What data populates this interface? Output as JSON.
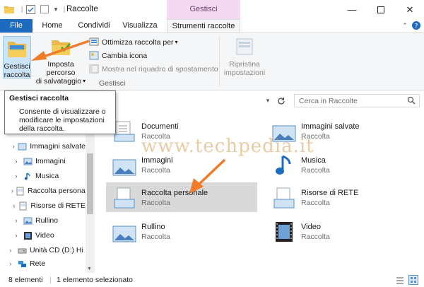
{
  "window": {
    "title": "Raccolte",
    "context_label": "Gestisci"
  },
  "tabs": {
    "file": "File",
    "home": "Home",
    "share": "Condividi",
    "view": "Visualizza",
    "tools": "Strumenti raccolte"
  },
  "ribbon": {
    "manage_line1": "Gestisci",
    "manage_line2": "raccolta",
    "save_line1": "Imposta percorso",
    "save_line2": "di salvataggio",
    "optimize": "Ottimizza raccolta per",
    "change_icon": "Cambia icona",
    "show_nav": "Mostra nel riquadro di spostamento",
    "restore_line1": "Ripristina",
    "restore_line2": "impostazioni",
    "group_name": "Gestisci"
  },
  "search": {
    "placeholder": "Cerca in Raccolte"
  },
  "tooltip": {
    "title": "Gestisci raccolta",
    "body": "Consente di visualizzare o modificare le impostazioni della raccolta."
  },
  "nav": [
    {
      "label": "Immagini salvate"
    },
    {
      "label": "Immagini"
    },
    {
      "label": "Musica"
    },
    {
      "label": "Raccolta personale"
    },
    {
      "label": "Risorse di RETE"
    },
    {
      "label": "Rullino"
    },
    {
      "label": "Video"
    },
    {
      "label": "Unità CD (D:) Hi"
    },
    {
      "label": "Rete"
    }
  ],
  "items": [
    {
      "name": "Documenti",
      "sub": "Raccolta"
    },
    {
      "name": "Immagini salvate",
      "sub": "Raccolta"
    },
    {
      "name": "Immagini",
      "sub": "Raccolta"
    },
    {
      "name": "Musica",
      "sub": "Raccolta"
    },
    {
      "name": "Raccolta personale",
      "sub": "Raccolta"
    },
    {
      "name": "Risorse di RETE",
      "sub": "Raccolta"
    },
    {
      "name": "Rullino",
      "sub": "Raccolta"
    },
    {
      "name": "Video",
      "sub": "Raccolta"
    }
  ],
  "status": {
    "count": "8 elementi",
    "selected": "1 elemento selezionato"
  },
  "watermark": "www.techpedia.it",
  "colors": {
    "file_tab": "#1c6bbf",
    "context_tab": "#f3daf0",
    "arrow": "#f07b2a",
    "selection": "#d9d9d9"
  }
}
